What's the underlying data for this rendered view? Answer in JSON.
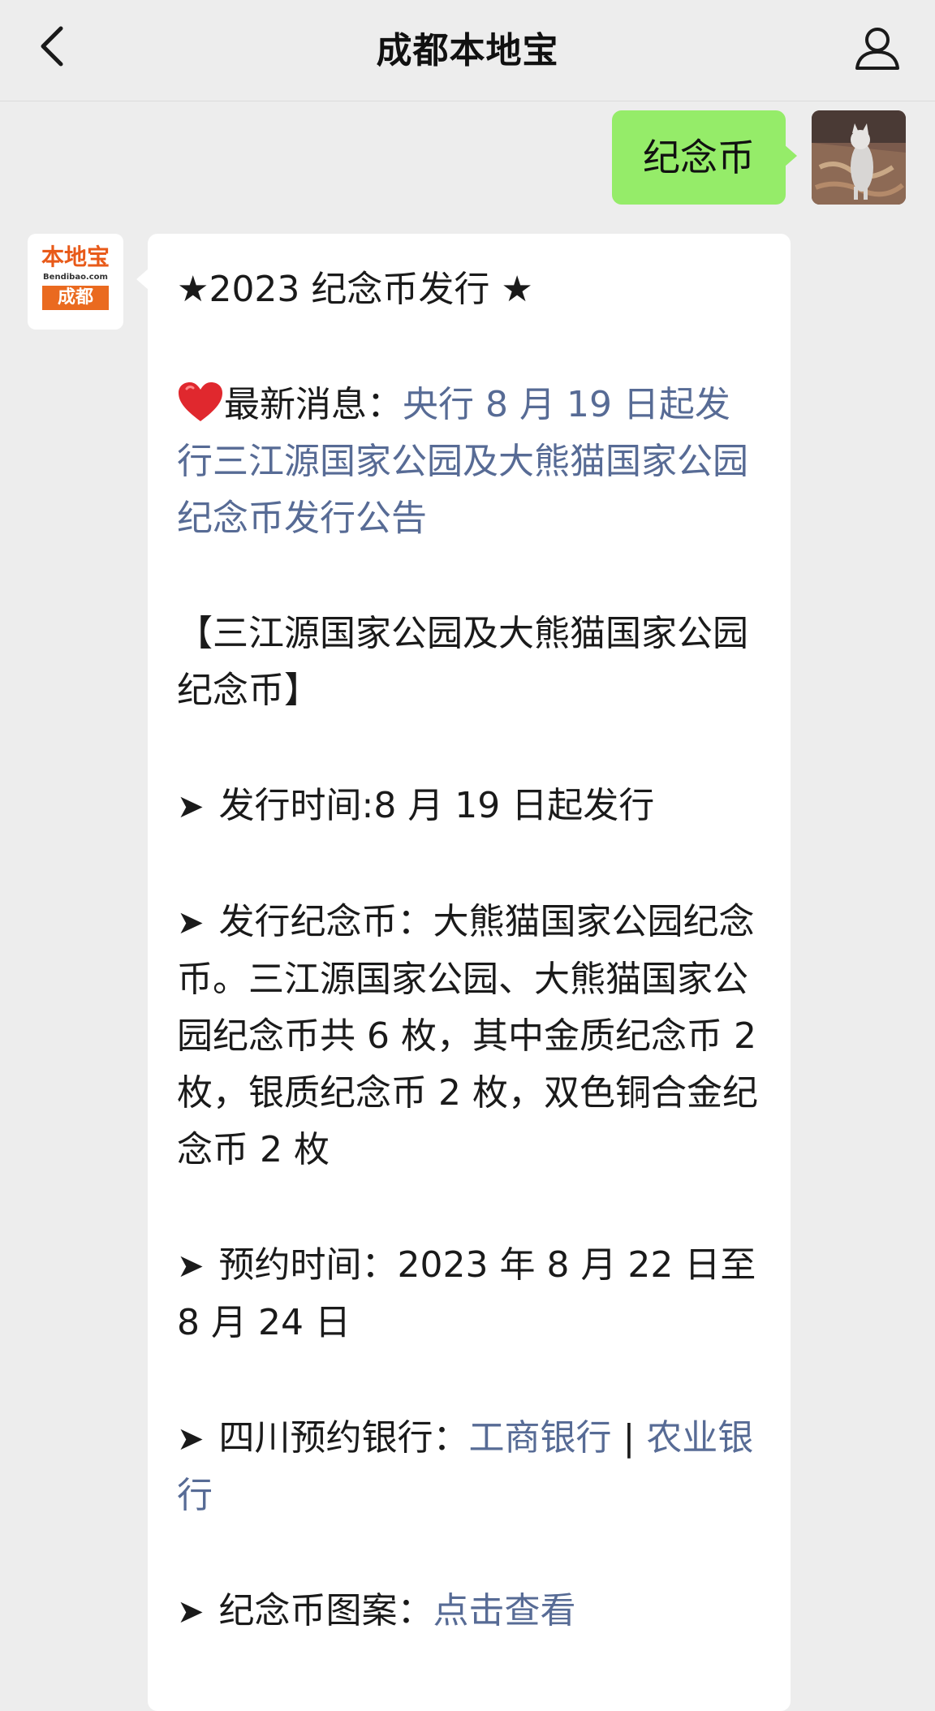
{
  "header": {
    "title": "成都本地宝"
  },
  "outgoing": {
    "text": "纪念币"
  },
  "incoming": {
    "avatar": {
      "logo_top": "本地宝",
      "logo_site": "Bendibao.com",
      "logo_city": "成都"
    },
    "headline": "★2023 纪念币发行 ★",
    "news_label": "最新消息：",
    "news_link": "央行 8 月 19 日起发行三江源国家公园及大熊猫国家公园纪念币发行公告",
    "coin_name": "【三江源国家公园及大熊猫国家公园纪念币】",
    "issue_time_label": "发行时间:",
    "issue_time_value": "8 月 19 日起发行",
    "coins_label": "发行纪念币：",
    "coins_value": "大熊猫国家公园纪念币。三江源国家公园、大熊猫国家公园纪念币共 6 枚，其中金质纪念币 2 枚，银质纪念币 2 枚，双色铜合金纪念币 2 枚",
    "reserve_time_label": "预约时间：",
    "reserve_time_value": "2023 年 8 月 22 日至8 月 24 日",
    "bank_label": "四川预约银行：",
    "bank_link_1": "工商银行",
    "bank_separator": " | ",
    "bank_link_2": "农业银行",
    "pattern_label": "纪念币图案：",
    "pattern_link": "点击查看"
  },
  "icons": {
    "back": "chevron-left-icon",
    "profile": "user-icon",
    "heart": "heart-icon",
    "arrow": "arrow-icon"
  },
  "colors": {
    "background": "#ededed",
    "outgoing_bubble": "#95ec69",
    "link": "#576b95",
    "heart": "#e0282e",
    "logo_orange": "#ea6a1f"
  }
}
